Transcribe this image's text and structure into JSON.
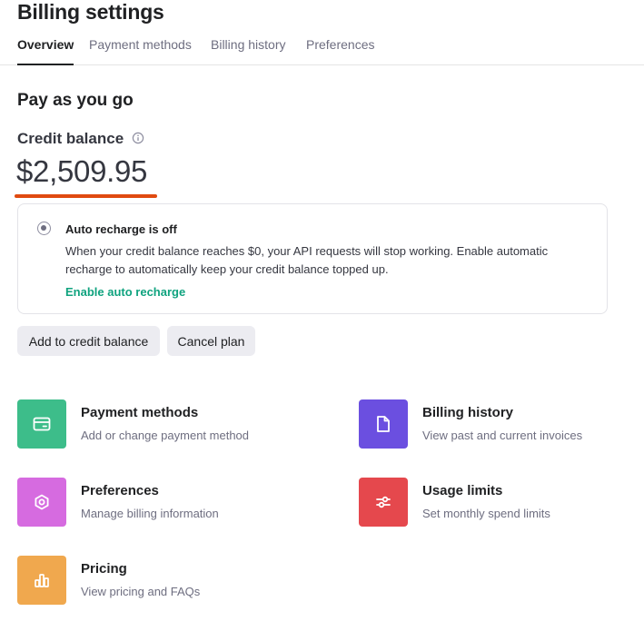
{
  "page_title": "Billing settings",
  "tabs": [
    {
      "label": "Overview",
      "active": true
    },
    {
      "label": "Payment methods",
      "active": false
    },
    {
      "label": "Billing history",
      "active": false
    },
    {
      "label": "Preferences",
      "active": false
    }
  ],
  "plan": {
    "title": "Pay as you go",
    "credit_label": "Credit balance",
    "info_icon": "info-icon",
    "balance": "$2,509.95",
    "underline_color": "#e04a10"
  },
  "auto_recharge": {
    "title": "Auto recharge is off",
    "description": "When your credit balance reaches $0, your API requests will stop working. Enable automatic recharge to automatically keep your credit balance topped up.",
    "link": "Enable auto recharge",
    "link_color": "#10a37f"
  },
  "buttons": {
    "add_credit": "Add to credit balance",
    "cancel_plan": "Cancel plan"
  },
  "cards": [
    {
      "title": "Payment methods",
      "subtitle": "Add or change payment method",
      "icon": "credit-card-icon",
      "color": "#3dbd8a"
    },
    {
      "title": "Billing history",
      "subtitle": "View past and current invoices",
      "icon": "document-icon",
      "color": "#6b4fe0"
    },
    {
      "title": "Preferences",
      "subtitle": "Manage billing information",
      "icon": "gear-icon",
      "color": "#d66be0"
    },
    {
      "title": "Usage limits",
      "subtitle": "Set monthly spend limits",
      "icon": "sliders-icon",
      "color": "#e5484d"
    },
    {
      "title": "Pricing",
      "subtitle": "View pricing and FAQs",
      "icon": "bar-chart-icon",
      "color": "#f0a84e"
    }
  ]
}
